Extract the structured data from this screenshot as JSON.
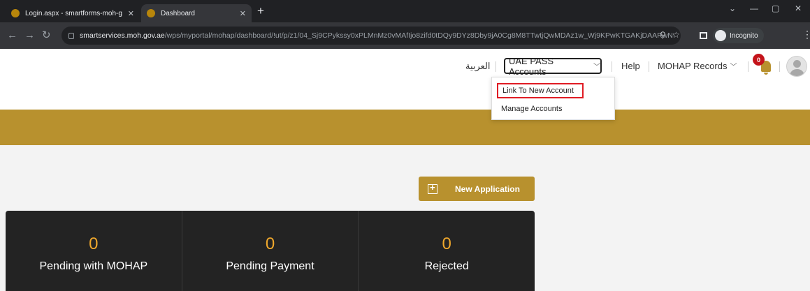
{
  "browser": {
    "tabs": [
      {
        "title": "Login.aspx - smartforms-moh-g",
        "active": false
      },
      {
        "title": "Dashboard",
        "active": true
      }
    ],
    "url_host": "smartservices.moh.gov.ae",
    "url_path": "/wps/myportal/mohap/dashboard/!ut/p/z1/04_Sj9CPykssy0xPLMnMz0vMAfIjo8zifd0tDQy9DYz8Dby9jA0Cg8M8TTwtjQwMDAz1w_Wj9KPwKTGAKjDAARwN9Au...",
    "incognito_label": "Incognito"
  },
  "header": {
    "language_link": "العربية",
    "uae_pass_label": "UAE PASS Accounts",
    "help_label": "Help",
    "records_label": "MOHAP Records",
    "notification_count": "0"
  },
  "dropdown": {
    "items": [
      "Link To New Account",
      "Manage Accounts"
    ]
  },
  "main": {
    "new_application_label": "New Application",
    "stats": [
      {
        "value": "0",
        "label": "Pending with MOHAP"
      },
      {
        "value": "0",
        "label": "Pending Payment"
      },
      {
        "value": "0",
        "label": "Rejected"
      }
    ]
  },
  "colors": {
    "brand_gold": "#b8912e",
    "stat_number": "#f0a82c",
    "highlight_red": "#e01c24",
    "stats_bg": "#232323"
  }
}
